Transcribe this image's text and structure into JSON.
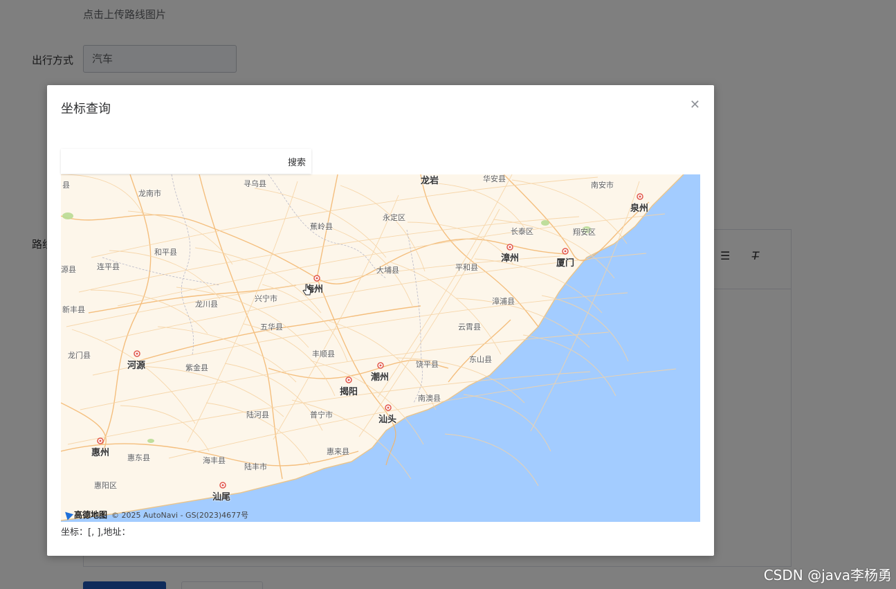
{
  "background_form": {
    "upload_hint": "点击上传路线图片",
    "travel_mode_label": "出行方式",
    "travel_mode_value": "汽车",
    "route_label": "路线"
  },
  "dialog": {
    "title": "坐标查询",
    "close_icon": "close-icon",
    "search_button": "搜索",
    "search_placeholder": "",
    "coord_text": "坐标：[, ],地址："
  },
  "map": {
    "provider_logo": "高德地图",
    "attribution": "© 2025 AutoNavi - GS(2023)4677号",
    "labels": {
      "longyan": "龙岩",
      "huaan": "华安县",
      "nanan": "南安市",
      "quanzhou": "泉州",
      "xunwu": "寻乌县",
      "longnan": "龙南市",
      "jiaoling": "蕉岭县",
      "yongding": "永定区",
      "changtai": "长泰区",
      "xiangan": "翔安区",
      "zhangzhou": "漳州",
      "xiamen": "厦门",
      "heping": "和平县",
      "lianping": "连平县",
      "yuan": "源县",
      "dapu": "大埔县",
      "pinghe": "平和县",
      "meizhou": "梅州",
      "xingning": "兴宁市",
      "longchuan": "龙川县",
      "xinfeng": "新丰县",
      "zhangpu": "漳浦县",
      "wuhua": "五华县",
      "yunxiao": "云霄县",
      "longmen": "龙门县",
      "heyuan": "河源",
      "zijin": "紫金县",
      "fengshun": "丰顺县",
      "raoping": "饶平县",
      "dongshan": "东山县",
      "chaozhou": "潮州",
      "jieyang": "揭阳",
      "nanao": "南澳县",
      "luhe": "陆河县",
      "puning": "普宁市",
      "shantou": "汕头",
      "huizhou": "惠州",
      "huidong": "惠东县",
      "haifeng": "海丰县",
      "huilai": "惠来县",
      "lufeng": "陆丰市",
      "huiyang": "惠阳区",
      "shanwei": "汕尾",
      "xian": "县"
    }
  },
  "watermark": "CSDN @java李杨勇"
}
